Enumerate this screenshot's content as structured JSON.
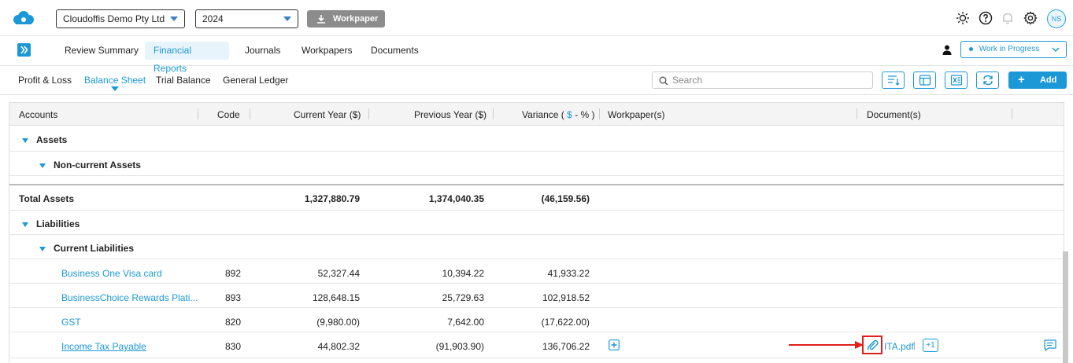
{
  "header": {
    "company_select": "Cloudoffis Demo Pty Ltd",
    "year_select": "2024",
    "workpaper_button": "Workpaper",
    "avatar_initials": "NS"
  },
  "nav": {
    "tabs": [
      {
        "label": "Review Summary"
      },
      {
        "label": "Financial Reports"
      },
      {
        "label": "Journals"
      },
      {
        "label": "Workpapers"
      },
      {
        "label": "Documents"
      }
    ],
    "active_tab": "Financial Reports",
    "status": "Work in Progress"
  },
  "subnav": {
    "tabs": [
      {
        "label": "Profit & Loss"
      },
      {
        "label": "Balance Sheet"
      },
      {
        "label": "Trial Balance"
      },
      {
        "label": "General Ledger"
      }
    ],
    "active_tab": "Balance Sheet",
    "search_placeholder": "Search",
    "add_button": "Add"
  },
  "table": {
    "columns": {
      "accounts": "Accounts",
      "code": "Code",
      "current_year": "Current Year ($)",
      "previous_year": "Previous Year ($)",
      "variance_prefix": "Variance (",
      "variance_dollar": "$",
      "variance_suffix": "- % )",
      "workpapers": "Workpaper(s)",
      "documents": "Document(s)"
    },
    "groups": {
      "assets": "Assets",
      "non_current_assets": "Non-current Assets",
      "liabilities": "Liabilities",
      "current_liabilities": "Current Liabilities"
    },
    "total_assets": {
      "label": "Total Assets",
      "current": "1,327,880.79",
      "previous": "1,374,040.35",
      "variance": "(46,159.56)"
    },
    "rows": [
      {
        "account": "Business One Visa card",
        "code": "892",
        "current": "52,327.44",
        "previous": "10,394.22",
        "variance": "41,933.22"
      },
      {
        "account": "BusinessChoice Rewards Plati...",
        "code": "893",
        "current": "128,648.15",
        "previous": "25,729.63",
        "variance": "102,918.52"
      },
      {
        "account": "GST",
        "code": "820",
        "current": "(9,980.00)",
        "previous": "7,642.00",
        "variance": "(17,622.00)"
      },
      {
        "account": "Income Tax Payable",
        "code": "830",
        "current": "44,802.32",
        "previous": "(91,903.90)",
        "variance": "136,706.22",
        "document": "ITA.pdf",
        "more_docs": "+1"
      }
    ]
  },
  "colors": {
    "accent": "#1c98d6",
    "annotation_red": "#e0201b"
  }
}
